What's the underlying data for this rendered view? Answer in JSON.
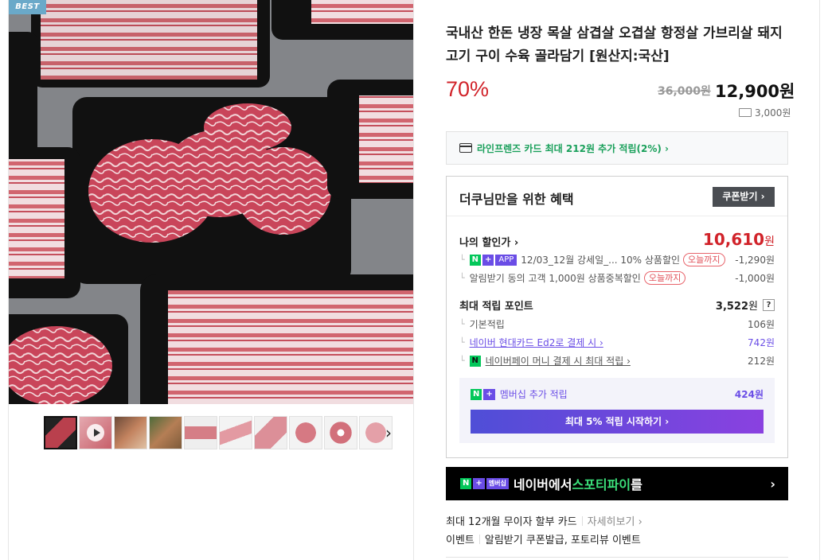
{
  "badge": "BEST",
  "product": {
    "title": "국내산 한돈 냉장 목살 삼겹살 오겹살 항정살 가브리살 돼지 고기 구이 수육 골라담기 [원산지:국산]",
    "discount_rate": "70%",
    "original_price": "36,000원",
    "sale_price": "12,900원",
    "shipping": "3,000원"
  },
  "card_promo": "라인프렌즈 카드 최대 212원 추가 적립(2%) ›",
  "benefits": {
    "heading": "더쿠님만을 위한 혜택",
    "coupon_button": "쿠폰받기 ›",
    "my_price_label": "나의 할인가 ›",
    "my_price_value": "10,610",
    "my_price_unit": "원",
    "discounts": [
      {
        "n": "N",
        "plus": "+",
        "app": "APP",
        "text": "12/03_12월 강세일_...  10% 상품할인",
        "tag": "오늘까지",
        "amount": "-1,290원"
      },
      {
        "text": "알림받기 동의 고객 1,000원 상품중복할인",
        "tag": "오늘까지",
        "amount": "-1,000원"
      }
    ],
    "points_label": "최대 적립 포인트",
    "points_value": "3,522",
    "points_unit": "원",
    "help": "?",
    "points": [
      {
        "label": "기본적립",
        "value": "106원"
      },
      {
        "label": "네이버 현대카드 Ed2로 결제 시 ›",
        "value": "742원"
      },
      {
        "label": "네이버페이 머니 결제 시 최대 적립 ›",
        "value": "212원"
      }
    ],
    "np_glyph": "N",
    "membership": {
      "n": "N",
      "plus": "+",
      "label": "멤버십 추가 적립",
      "value": "424원",
      "button": "최대 5% 적립 시작하기 ›"
    }
  },
  "spotify": {
    "n": "N",
    "plus": "+",
    "badge": "멤버십",
    "text_prefix": "네이버에서 ",
    "text_highlight": "스포티파이",
    "text_suffix": "를",
    "arrow": "›"
  },
  "installment": {
    "text": "최대 12개월 무이자 할부 카드",
    "link": "자세히보기 ›"
  },
  "events": {
    "label": "이벤트",
    "text": "알림받기 쿠폰발급, 포토리뷰 이벤트"
  },
  "thumbnails_next": "›",
  "colors": {
    "accent_red": "#d1232a",
    "naver_green": "#03c75a",
    "membership_purple": "#6a4de6"
  }
}
